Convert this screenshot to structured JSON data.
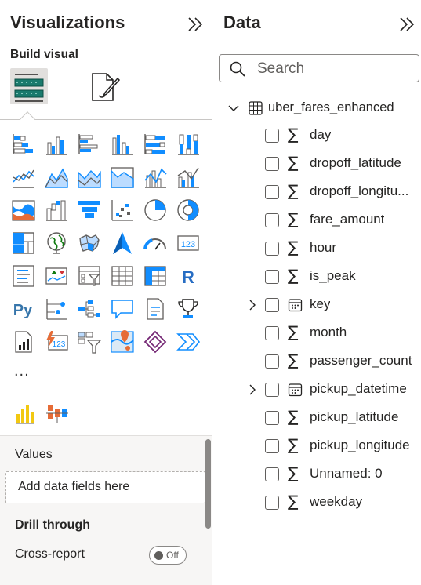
{
  "visualizations": {
    "title": "Visualizations",
    "build_visual_label": "Build visual",
    "more_label": "...",
    "values_label": "Values",
    "add_fields_placeholder": "Add data fields here",
    "drill_through_label": "Drill through",
    "cross_report_label": "Cross-report",
    "cross_report_toggle": "Off",
    "visual_icons": [
      [
        "stacked-bar-chart-icon",
        "clustered-bar-chart-icon",
        "clustered-bar-horizontal-icon",
        "clustered-column-chart-icon",
        "100-stacked-bar-icon",
        "100-stacked-column-icon"
      ],
      [
        "line-chart-icon",
        "area-chart-icon",
        "stacked-area-chart-icon",
        "100-stacked-area-icon",
        "line-stacked-column-icon",
        "line-clustered-column-icon"
      ],
      [
        "ribbon-chart-icon",
        "waterfall-chart-icon",
        "funnel-chart-icon",
        "scatter-chart-icon",
        "pie-chart-icon",
        "donut-chart-icon"
      ],
      [
        "treemap-icon",
        "map-icon",
        "filled-map-icon",
        "azure-map-icon",
        "gauge-icon",
        "card-icon"
      ],
      [
        "multi-row-card-icon",
        "kpi-icon",
        "slicer-icon",
        "table-icon",
        "matrix-icon",
        "r-visual-icon"
      ],
      [
        "python-visual-icon",
        "key-influencers-icon",
        "decomposition-tree-icon",
        "qa-icon",
        "smart-narrative-icon",
        "metrics-icon"
      ],
      [
        "paginated-report-icon",
        "power-apps-icon",
        "button-slicer-icon",
        "arcgis-map-icon",
        "power-automate-icon",
        "power-automate-flow-icon"
      ]
    ]
  },
  "data": {
    "title": "Data",
    "search_placeholder": "Search",
    "table_name": "uber_fares_enhanced",
    "fields": [
      {
        "name": "day",
        "type": "sigma",
        "expandable": false
      },
      {
        "name": "dropoff_latitude",
        "type": "sigma",
        "expandable": false
      },
      {
        "name": "dropoff_longitu...",
        "type": "sigma",
        "expandable": false
      },
      {
        "name": "fare_amount",
        "type": "sigma",
        "expandable": false
      },
      {
        "name": "hour",
        "type": "sigma",
        "expandable": false
      },
      {
        "name": "is_peak",
        "type": "sigma",
        "expandable": false
      },
      {
        "name": "key",
        "type": "calendar",
        "expandable": true
      },
      {
        "name": "month",
        "type": "sigma",
        "expandable": false
      },
      {
        "name": "passenger_count",
        "type": "sigma",
        "expandable": false
      },
      {
        "name": "pickup_datetime",
        "type": "calendar",
        "expandable": true
      },
      {
        "name": "pickup_latitude",
        "type": "sigma",
        "expandable": false
      },
      {
        "name": "pickup_longitude",
        "type": "sigma",
        "expandable": false
      },
      {
        "name": "Unnamed: 0",
        "type": "sigma",
        "expandable": false
      },
      {
        "name": "weekday",
        "type": "sigma",
        "expandable": false
      }
    ],
    "sigma_glyph": "∑"
  },
  "colors": {
    "accent_blue": "#118dff",
    "teal": "#1a7a6d",
    "icon_gray": "#605e5c",
    "orange": "#e66c37",
    "yellow": "#f2c811"
  }
}
